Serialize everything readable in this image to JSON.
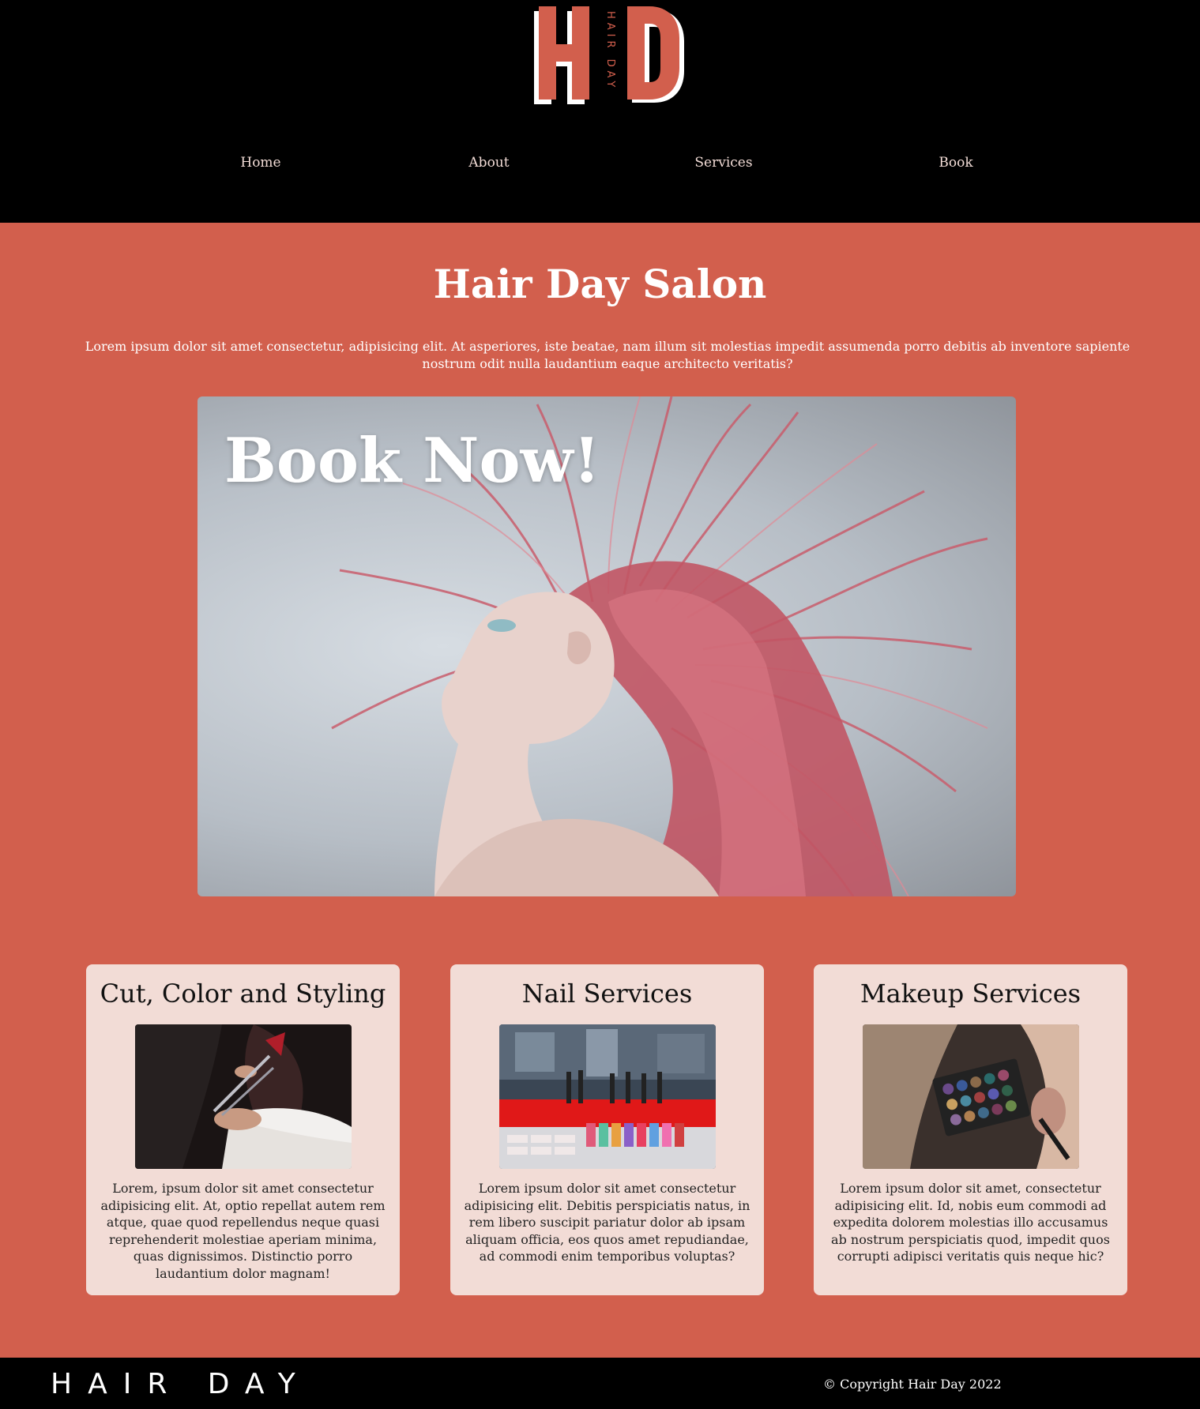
{
  "brand": {
    "logo_letters": "HD",
    "logo_text": "HAIR DAY",
    "accent": "#d25f4d",
    "card_bg": "#f2dcd6"
  },
  "nav": {
    "items": [
      {
        "label": "Home"
      },
      {
        "label": "About"
      },
      {
        "label": "Services"
      },
      {
        "label": "Book"
      }
    ]
  },
  "hero": {
    "title": "Hair Day Salon",
    "intro": "Lorem ipsum dolor sit amet consectetur, adipisicing elit. At asperiores, iste beatae, nam illum sit molestias impedit assumenda porro debitis ab inventore sapiente nostrum odit nulla laudantium eaque architecto veritatis?",
    "banner_label": "Book Now!"
  },
  "services": [
    {
      "title": "Cut, Color and Styling",
      "text": "Lorem, ipsum dolor sit amet consectetur adipisicing elit. At, optio repellat autem rem atque, quae quod repellendus neque quasi reprehenderit molestiae aperiam minima, quas dignissimos. Distinctio porro laudantium dolor magnam!"
    },
    {
      "title": "Nail Services",
      "text": "Lorem ipsum dolor sit amet consectetur adipisicing elit. Debitis perspiciatis natus, in rem libero suscipit pariatur dolor ab ipsam aliquam officia, eos quos amet repudiandae, ad commodi enim temporibus voluptas?"
    },
    {
      "title": "Makeup Services",
      "text": "Lorem ipsum dolor sit amet, consectetur adipisicing elit. Id, nobis eum commodi ad expedita dolorem molestias illo accusamus ab nostrum perspiciatis quod, impedit quos corrupti adipisci veritatis quis neque hic?"
    }
  ],
  "footer": {
    "logo_text": "HAIR DAY",
    "copyright": "© Copyright Hair Day 2022"
  }
}
